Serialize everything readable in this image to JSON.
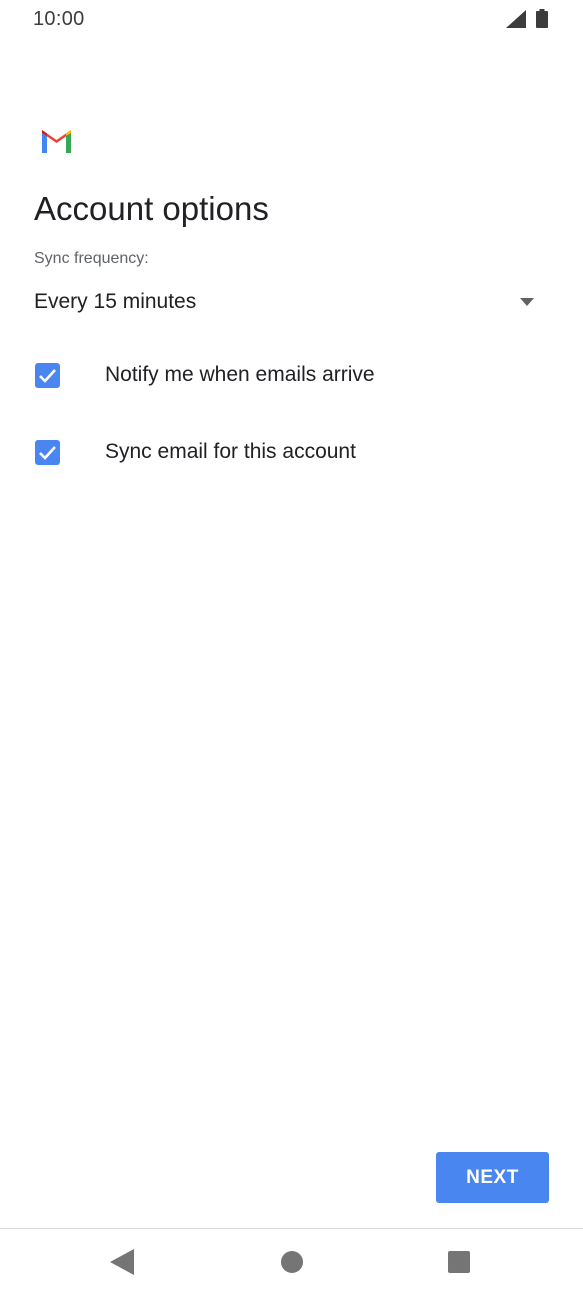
{
  "status_bar": {
    "time": "10:00",
    "icons": [
      "signal-icon",
      "battery-icon"
    ]
  },
  "app": {
    "logo": "gmail-logo-icon"
  },
  "page": {
    "title": "Account options"
  },
  "sync": {
    "label": "Sync frequency:",
    "selected_value": "Every 15 minutes"
  },
  "options": [
    {
      "label": "Notify me when emails arrive",
      "checked": true
    },
    {
      "label": "Sync email for this account",
      "checked": true
    }
  ],
  "actions": {
    "next_label": "NEXT"
  },
  "navigation": {
    "buttons": [
      "back-icon",
      "home-icon",
      "recents-icon"
    ]
  },
  "colors": {
    "accent": "#4a86f0",
    "text_primary": "#202124",
    "text_secondary": "#5f6368",
    "nav_icon": "#757575"
  }
}
